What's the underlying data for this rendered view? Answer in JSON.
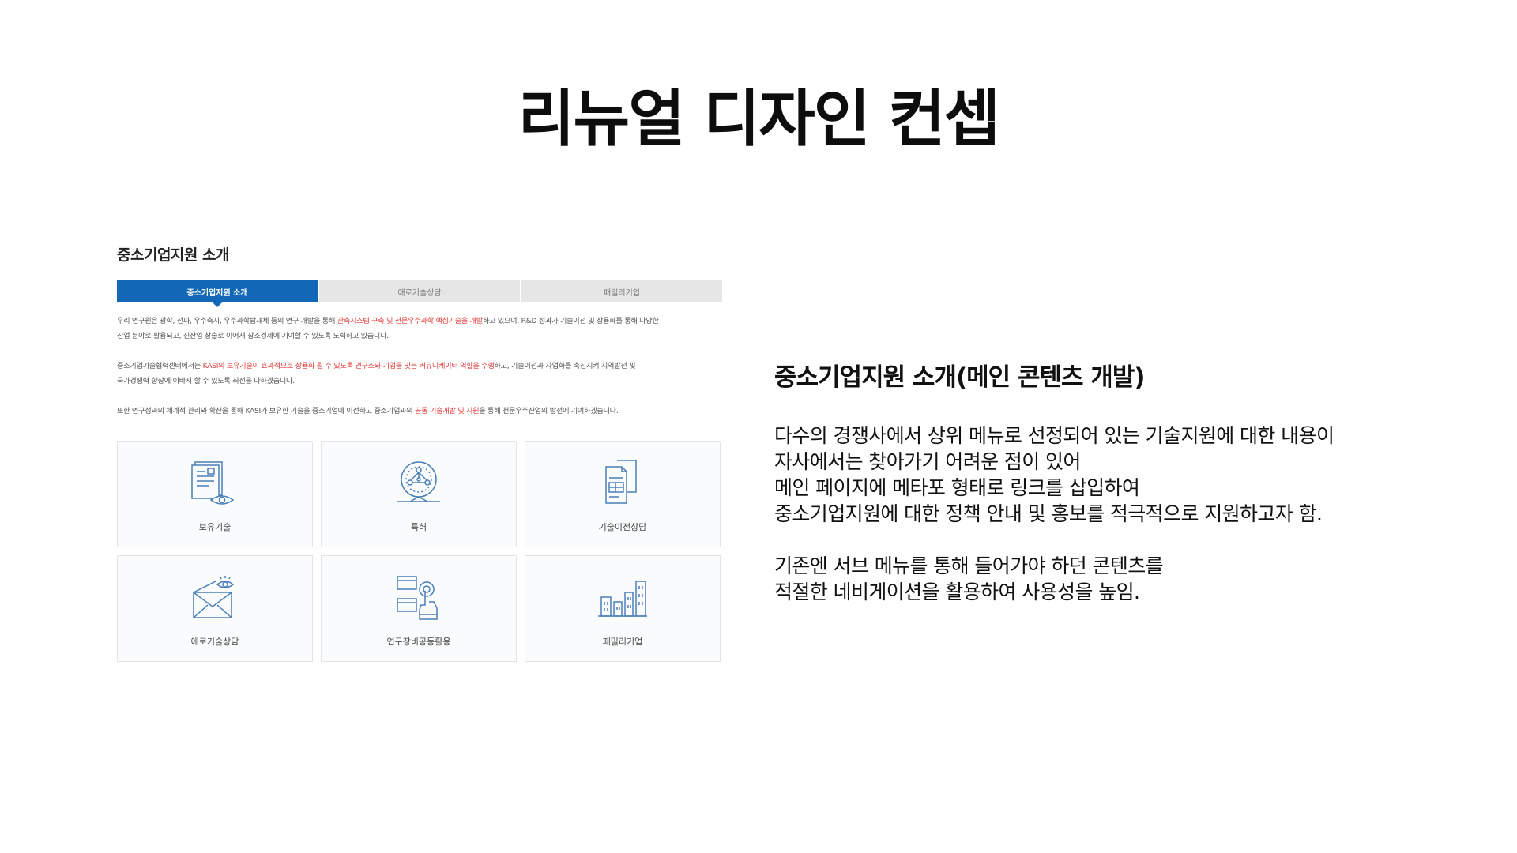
{
  "slide": {
    "title": "리뉴얼 디자인 컨셉"
  },
  "mock": {
    "heading": "중소기업지원 소개",
    "tabs": [
      {
        "label": "중소기업지원 소개",
        "active": true
      },
      {
        "label": "애로기술상담",
        "active": false
      },
      {
        "label": "패밀리기업",
        "active": false
      }
    ],
    "paragraph1": {
      "a": "우리 연구원은 광학, 전파, 우주측지, 우주과학탑재체 등의 연구 개발을 통해 ",
      "hl": "관측시스템 구축 및 천문우주과학 핵심기술을 개발",
      "b": "하고 있으며, R&D 성과가 기술이전 및 상용화를 통해 다양한",
      "c": "산업 분야로 활용되고, 신산업 창출로 이어져 창조경제에 기여할 수 있도록 노력하고 있습니다."
    },
    "paragraph2": {
      "a": "중소기업기술협력센터에서는 ",
      "hl": "KASI의 보유기술이 효과적으로 상용화 될 수 있도록 연구소와 기업을 잇는 커뮤니케이터 역할을 수행",
      "b": "하고, 기술이전과 사업화를 촉진시켜 지역발전 및",
      "c": "국가경쟁력 향상에 이바지 할 수 있도록 최선을 다하겠습니다."
    },
    "paragraph3": {
      "a": "또한 연구성과의 체계적 관리와 확산을 통해 KASI가 보유한 기술을 중소기업에 이전하고 중소기업과의 ",
      "hl": "공동 기술개발 및 지원",
      "b": "을 통해 천문우주산업의 발전에 기여하겠습니다."
    },
    "cards": [
      {
        "label": "보유기술",
        "icon": "document-eye-icon"
      },
      {
        "label": "특허",
        "icon": "globe-network-icon"
      },
      {
        "label": "기술이전상담",
        "icon": "documents-transfer-icon"
      },
      {
        "label": "애로기술상담",
        "icon": "envelope-eye-icon"
      },
      {
        "label": "연구장비공동활용",
        "icon": "touch-equipment-icon"
      },
      {
        "label": "패밀리기업",
        "icon": "buildings-icon"
      }
    ],
    "colors": {
      "accent": "#1268b6",
      "highlight": "#e03a3a",
      "icon": "#4a7fb8"
    }
  },
  "description": {
    "title": "중소기업지원 소개(메인 콘텐츠 개발)",
    "lines1": [
      "다수의 경쟁사에서 상위 메뉴로 선정되어 있는 기술지원에 대한 내용이",
      "자사에서는 찾아가기 어려운 점이 있어",
      "메인 페이지에 메타포 형태로 링크를 삽입하여",
      "중소기업지원에 대한 정책 안내 및 홍보를 적극적으로 지원하고자 함."
    ],
    "lines2": [
      "기존엔 서브 메뉴를 통해 들어가야 하던 콘텐츠를",
      "적절한 네비게이션을 활용하여 사용성을 높임."
    ]
  }
}
